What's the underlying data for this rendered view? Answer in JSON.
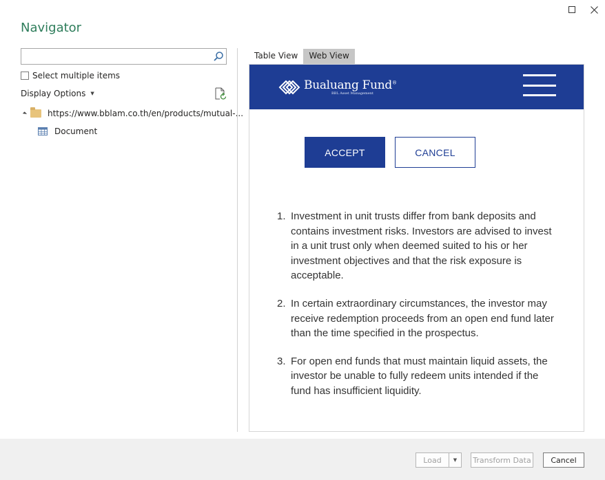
{
  "window": {
    "title": "Navigator",
    "maximize_icon": "maximize-icon",
    "close_icon": "close-icon"
  },
  "left_panel": {
    "search": {
      "value": "",
      "placeholder": "",
      "icon": "search-icon"
    },
    "select_multiple_label": "Select multiple items",
    "display_options_label": "Display Options",
    "refresh_icon": "refresh-icon",
    "tree": {
      "root_label": "https://www.bblam.co.th/en/products/mutual-...",
      "root_icon": "folder-icon",
      "children": [
        {
          "label": "Document",
          "icon": "table-icon"
        }
      ]
    }
  },
  "right_panel": {
    "tabs": [
      {
        "label": "Table View",
        "active": false
      },
      {
        "label": "Web View",
        "active": true
      }
    ],
    "webview": {
      "brand_name": "Bualuang Fund",
      "brand_mark": "®",
      "brand_sub": "BBL Asset Management",
      "accept_label": "ACCEPT",
      "cancel_label": "CANCEL",
      "terms": [
        {
          "num": "1.",
          "text": "Investment in unit trusts differ from bank deposits and contains investment risks. Investors are advised to invest in a unit trust only when deemed suited to his or her investment objectives and that the risk exposure is acceptable."
        },
        {
          "num": "2.",
          "text": "In certain extraordinary circumstances, the investor may receive redemption proceeds from an open end fund later than the time specified in the prospectus."
        },
        {
          "num": "3.",
          "text": "For open end funds that must maintain liquid assets, the investor be unable to fully redeem units intended if the fund has insufficient liquidity."
        }
      ]
    }
  },
  "footer": {
    "load_label": "Load",
    "transform_label": "Transform Data",
    "cancel_label": "Cancel"
  },
  "colors": {
    "title_green": "#2e7d5b",
    "brand_blue": "#1e3d94"
  }
}
